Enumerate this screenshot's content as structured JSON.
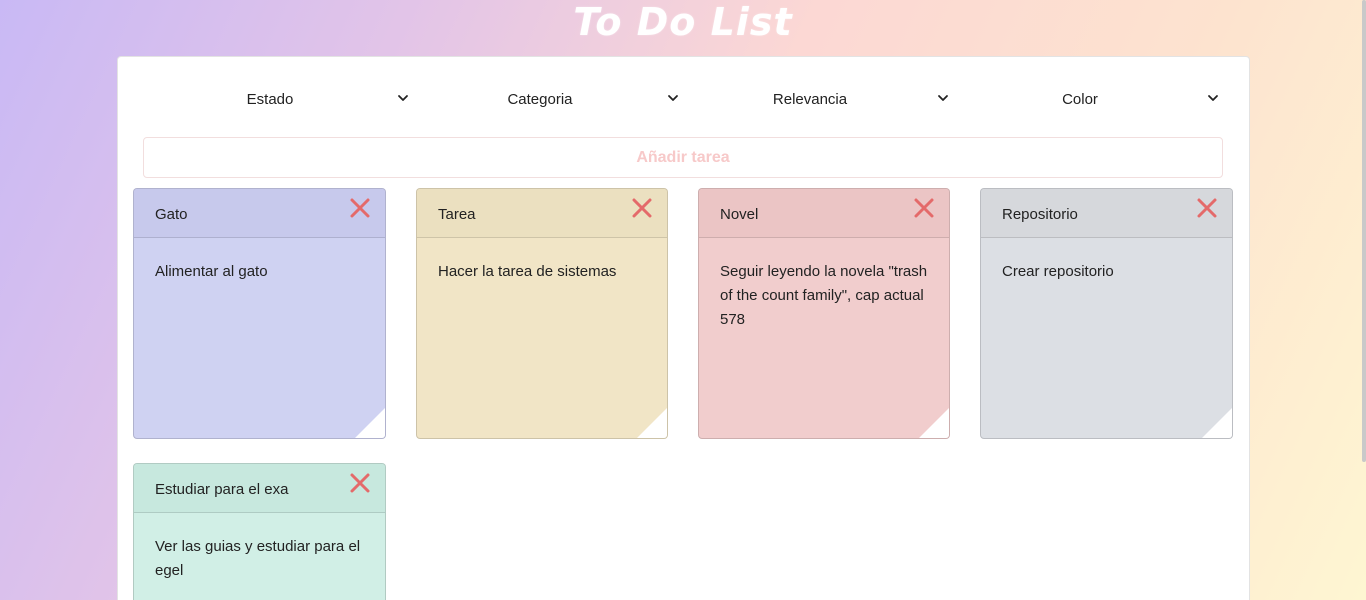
{
  "app": {
    "title": "To Do List"
  },
  "filters": [
    {
      "label": "Estado"
    },
    {
      "label": "Categoria"
    },
    {
      "label": "Relevancia"
    },
    {
      "label": "Color"
    }
  ],
  "add_task": {
    "placeholder": "Añadir tarea"
  },
  "colors": {
    "close_icon": "#e46a6a",
    "placeholder": "#f7c9c9"
  },
  "cards": [
    {
      "title": "Gato",
      "body": "Alimentar al gato",
      "color": "blue"
    },
    {
      "title": "Tarea",
      "body": "Hacer la tarea de sistemas",
      "color": "yellow"
    },
    {
      "title": "Novel",
      "body": "Seguir leyendo la novela \"trash of the count family\", cap actual 578",
      "color": "pink"
    },
    {
      "title": "Repositorio",
      "body": "Crear repositorio",
      "color": "gray"
    },
    {
      "title": "Estudiar para el exa",
      "body": "Ver las guias y estudiar para el egel",
      "color": "green"
    }
  ],
  "icons": {
    "filter_toggle": "chevron-down-icon",
    "card_delete": "close-icon"
  }
}
